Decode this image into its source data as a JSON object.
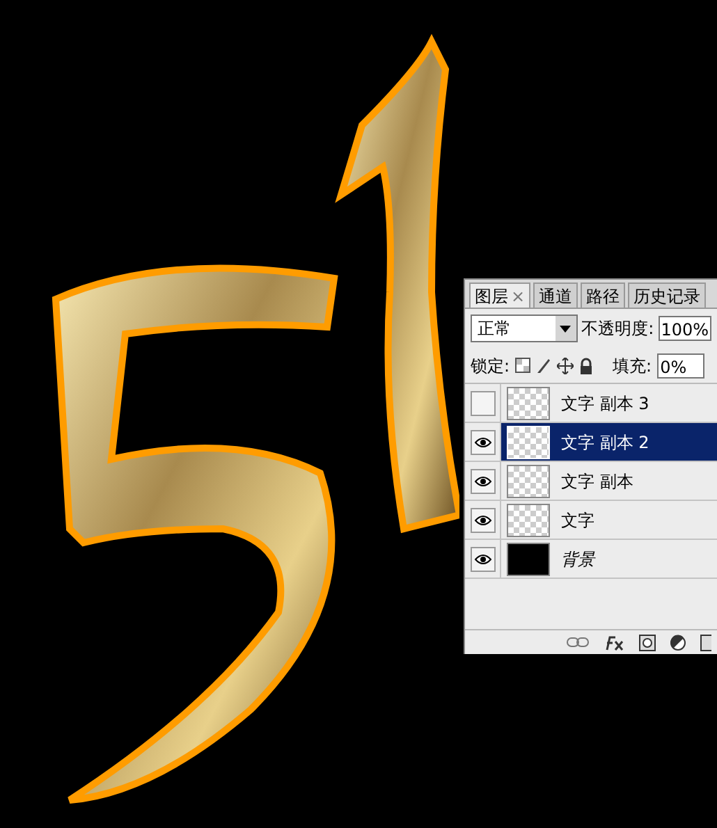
{
  "layers_panel": {
    "tabs": [
      {
        "label": "图层",
        "close": "×",
        "selected": true
      },
      {
        "label": "通道",
        "selected": false
      },
      {
        "label": "路径",
        "selected": false
      },
      {
        "label": "历史记录",
        "selected": false
      }
    ],
    "blend_mode": "正常",
    "opacity_label": "不透明度:",
    "opacity": "100%",
    "lock_label": "锁定:",
    "fill_label": "填充:",
    "fill": "0%",
    "layers": [
      {
        "name": "文字 副本 3",
        "kind": "text",
        "visible": false,
        "selected": false
      },
      {
        "name": "文字 副本 2",
        "kind": "text",
        "visible": true,
        "selected": true
      },
      {
        "name": "文字 副本",
        "kind": "text",
        "visible": true,
        "selected": false
      },
      {
        "name": "文字",
        "kind": "text",
        "visible": true,
        "selected": false
      },
      {
        "name": "背景",
        "kind": "background",
        "visible": true,
        "selected": false
      }
    ]
  }
}
